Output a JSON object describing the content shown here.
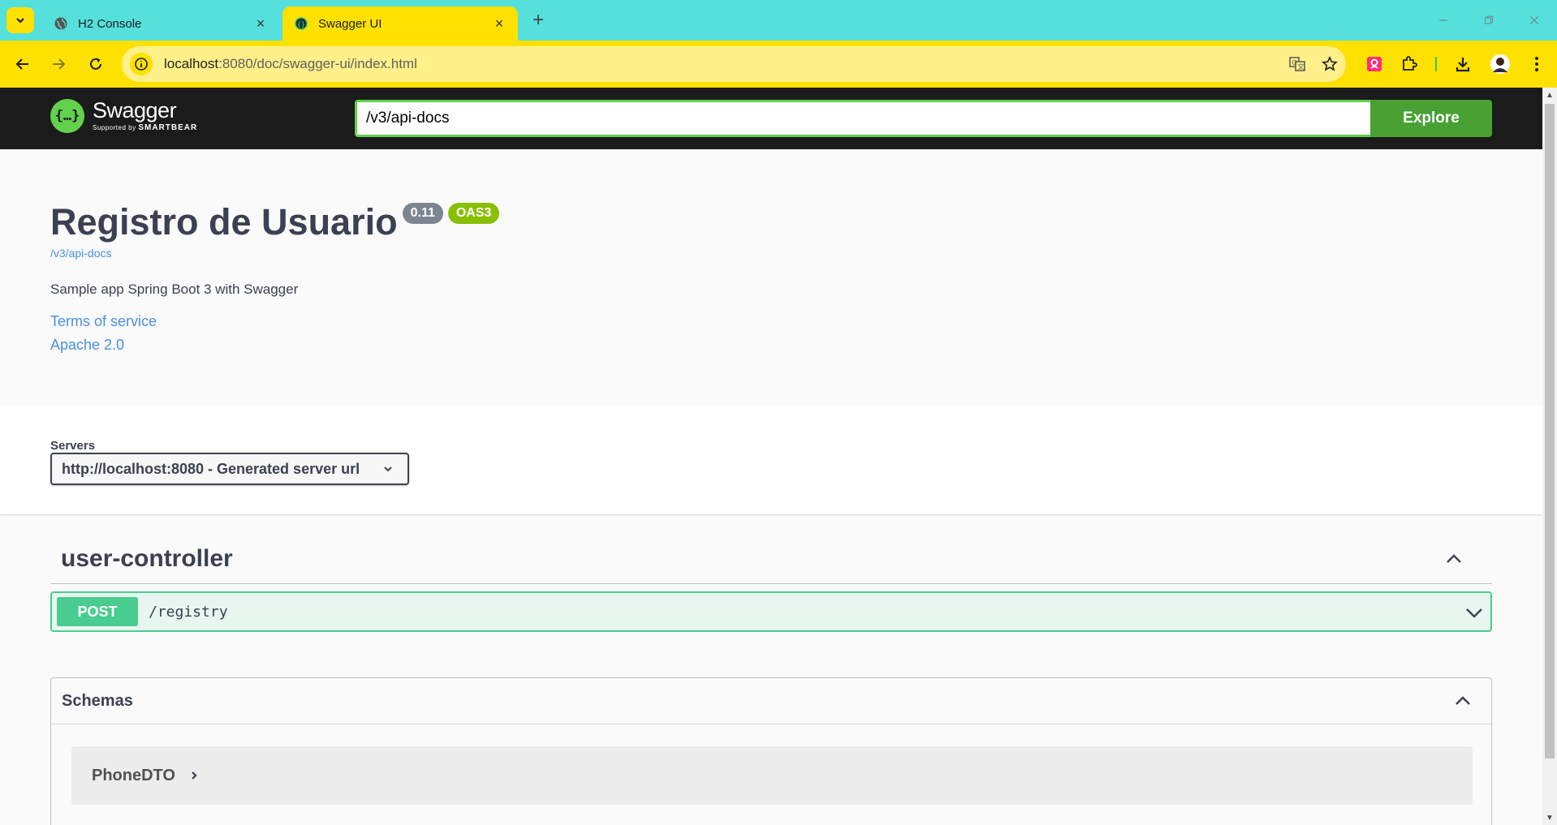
{
  "browser": {
    "tabs": [
      {
        "label": "H2 Console",
        "active": false
      },
      {
        "label": "Swagger UI",
        "active": true
      }
    ],
    "address": {
      "host": "localhost",
      "path": ":8080/doc/swagger-ui/index.html"
    },
    "colors": {
      "tabbar": "#56e0dc",
      "toolbar": "#ffe100"
    }
  },
  "swagger": {
    "logo_text": "Swagger",
    "logo_supported": "Supported by",
    "logo_brand": "SMARTBEAR",
    "url_value": "/v3/api-docs",
    "explore_label": "Explore"
  },
  "info": {
    "title": "Registro de Usuario",
    "version": "0.11",
    "oas": "OAS3",
    "spec_url": "/v3/api-docs",
    "description": "Sample app Spring Boot 3 with Swagger",
    "terms_link": "Terms of service",
    "license_link": "Apache 2.0"
  },
  "servers": {
    "label": "Servers",
    "selected": "http://localhost:8080 - Generated server url"
  },
  "operations": {
    "tag": "user-controller",
    "items": [
      {
        "method": "POST",
        "path": "/registry"
      }
    ]
  },
  "schemas": {
    "title": "Schemas",
    "models": [
      "PhoneDTO"
    ]
  }
}
